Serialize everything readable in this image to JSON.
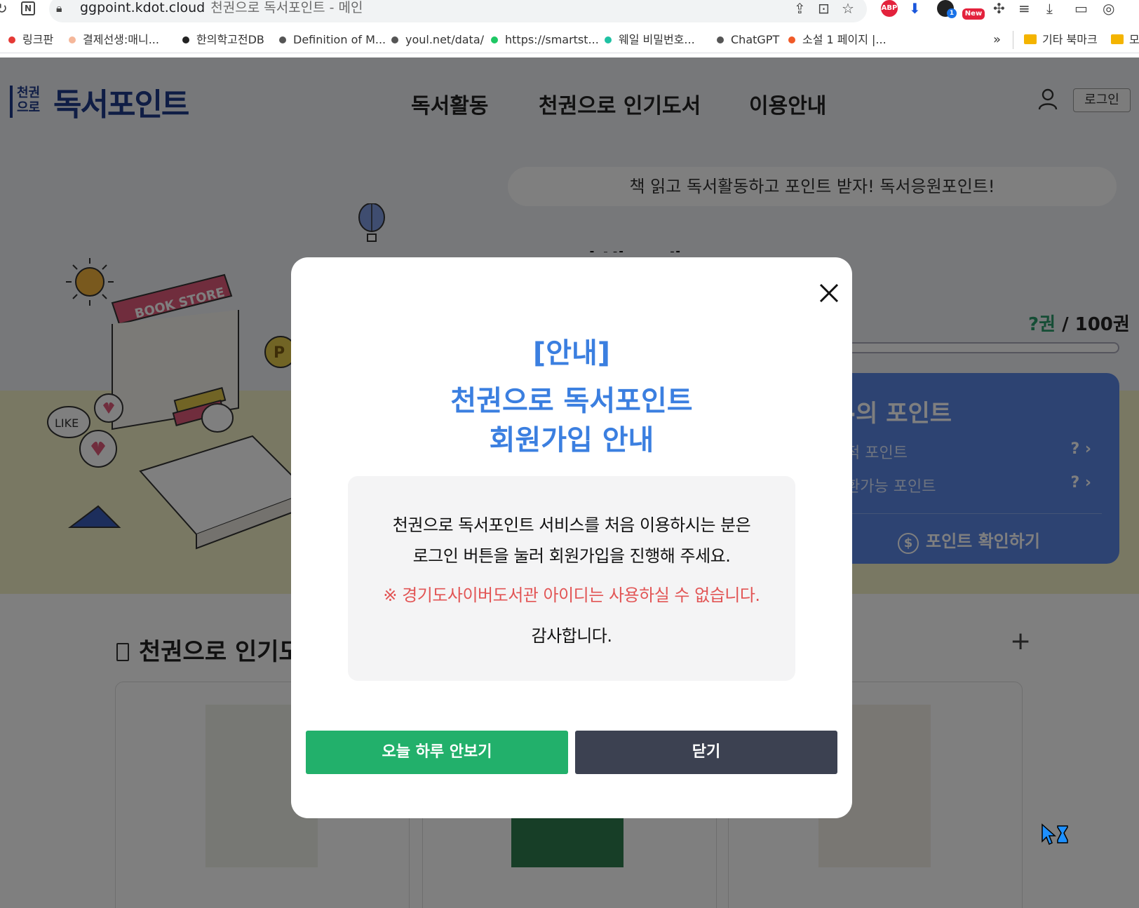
{
  "browser": {
    "url_host": "ggpoint.kdot.cloud",
    "tab_title": "천권으로 독서포인트 - 메인",
    "extensions": {
      "abp_label": "ABP",
      "badge_count": "1",
      "new_label": "New"
    },
    "bookmarks": [
      {
        "label": "링크판",
        "color": "#e53935"
      },
      {
        "label": "결제선생:매니...",
        "color": "#f5b79a"
      },
      {
        "label": "한의학고전DB",
        "color": "#222222"
      },
      {
        "label": "Definition of M...",
        "color": "#555555"
      },
      {
        "label": "youl.net/data/",
        "color": "#555555"
      },
      {
        "label": "https://smartst...",
        "color": "#1ec764"
      },
      {
        "label": "웨일 비밀번호...",
        "color": "#1fc1a3"
      },
      {
        "label": "ChatGPT",
        "color": "#555555"
      },
      {
        "label": "소설 1 페이지 |...",
        "color": "#f05a28"
      }
    ],
    "overflow_label": "»",
    "folders": [
      {
        "label": "기타 북마크"
      },
      {
        "label": "모"
      }
    ]
  },
  "site": {
    "logo_mark": "천권\n으로",
    "logo_text": "독서포인트",
    "nav": [
      "독서활동",
      "천권으로 인기도서",
      "이용안내"
    ],
    "login_label": "로그인",
    "slogan": "책 읽고 독서활동하고 포인트 받자! 독서응원포인트!",
    "login_prompt": "로그인해주세요",
    "count_current": "?권",
    "count_total": " / 100권",
    "illustration_sign": "BOOK STORE",
    "illustration_like": "LIKE",
    "point_card": {
      "title": "-의 포인트",
      "row1_label": "적 포인트",
      "row1_value": "? ›",
      "row2_label": "환가능 포인트",
      "row2_value": "? ›",
      "button_label": "포인트 확인하기",
      "coin_symbol": "$"
    },
    "popular_title": "천권으로 인기도",
    "plus_label": "+"
  },
  "modal": {
    "title_line1": "[안내]",
    "title_line2": "천권으로 독서포인트",
    "title_line3": "회원가입 안내",
    "body_line1": "천권으로 독서포인트 서비스를 처음 이용하시는 분은",
    "body_line2": "로그인 버튼을 눌러 회원가입을 진행해 주세요.",
    "warning": "※ 경기도사이버도서관 아이디는 사용하실 수 없습니다.",
    "thanks": "감사합니다.",
    "btn_hide_today": "오늘 하루 안보기",
    "btn_close": "닫기",
    "accent_color": "#3b7fe0",
    "warning_color": "#e25555"
  }
}
